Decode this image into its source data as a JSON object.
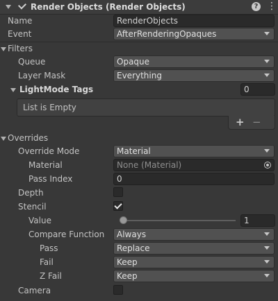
{
  "header": {
    "title": "Render Objects (Render Objects)",
    "enabled": true
  },
  "fields": {
    "name": {
      "label": "Name",
      "value": "RenderObjects"
    },
    "event": {
      "label": "Event",
      "value": "AfterRenderingOpaques"
    }
  },
  "filters": {
    "title": "Filters",
    "queue": {
      "label": "Queue",
      "value": "Opaque"
    },
    "layer_mask": {
      "label": "Layer Mask",
      "value": "Everything"
    },
    "lightmode_tags": {
      "label": "LightMode Tags",
      "count": "0",
      "empty_text": "List is Empty"
    }
  },
  "overrides": {
    "title": "Overrides",
    "override_mode": {
      "label": "Override Mode",
      "value": "Material"
    },
    "material": {
      "label": "Material",
      "value": "None (Material)"
    },
    "pass_index": {
      "label": "Pass Index",
      "value": "0"
    },
    "depth": {
      "label": "Depth",
      "checked": false
    },
    "stencil": {
      "label": "Stencil",
      "checked": true,
      "value": {
        "label": "Value",
        "value": "1",
        "slider_fraction": 0.0
      },
      "compare_function": {
        "label": "Compare Function",
        "value": "Always"
      },
      "pass": {
        "label": "Pass",
        "value": "Replace"
      },
      "fail": {
        "label": "Fail",
        "value": "Keep"
      },
      "z_fail": {
        "label": "Z Fail",
        "value": "Keep"
      }
    },
    "camera": {
      "label": "Camera",
      "checked": false
    }
  },
  "icons": {
    "help": "help-icon",
    "settings": "settings-icon",
    "object_picker": "object-picker-icon",
    "add": "+",
    "remove": "−"
  }
}
